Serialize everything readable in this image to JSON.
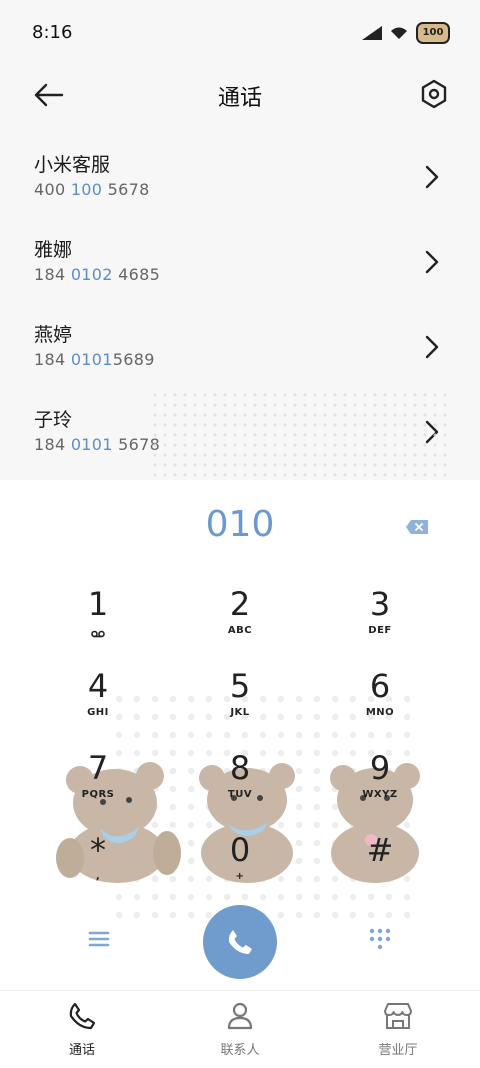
{
  "status": {
    "time": "8:16",
    "battery": "100"
  },
  "header": {
    "title": "通话"
  },
  "contacts": [
    {
      "name": "小米客服",
      "num_pre": "400 ",
      "num_hl": "100",
      "num_post": " 5678"
    },
    {
      "name": "雅娜",
      "num_pre": "184 ",
      "num_hl": "0102",
      "num_post": " 4685"
    },
    {
      "name": "燕婷",
      "num_pre": "184 ",
      "num_hl": "0101",
      "num_post": "5689"
    },
    {
      "name": "子玲",
      "num_pre": "184 ",
      "num_hl": "0101",
      "num_post": " 5678"
    }
  ],
  "dialer": {
    "input": "010",
    "keys": [
      {
        "digit": "1",
        "letters": ""
      },
      {
        "digit": "2",
        "letters": "ABC"
      },
      {
        "digit": "3",
        "letters": "DEF"
      },
      {
        "digit": "4",
        "letters": "GHI"
      },
      {
        "digit": "5",
        "letters": "JKL"
      },
      {
        "digit": "6",
        "letters": "MNO"
      },
      {
        "digit": "7",
        "letters": "PQRS"
      },
      {
        "digit": "8",
        "letters": "TUV"
      },
      {
        "digit": "9",
        "letters": "WXYZ"
      },
      {
        "digit": "*",
        "letters": ","
      },
      {
        "digit": "0",
        "letters": "+"
      },
      {
        "digit": "#",
        "letters": ""
      }
    ]
  },
  "tabs": [
    {
      "label": "通话",
      "icon": "phone-icon",
      "active": true
    },
    {
      "label": "联系人",
      "icon": "person-icon",
      "active": false
    },
    {
      "label": "营业厅",
      "icon": "store-icon",
      "active": false
    }
  ],
  "colors": {
    "accent": "#6f9bcd",
    "highlight": "#5b8ec8",
    "bear": "#c8b7a6"
  }
}
